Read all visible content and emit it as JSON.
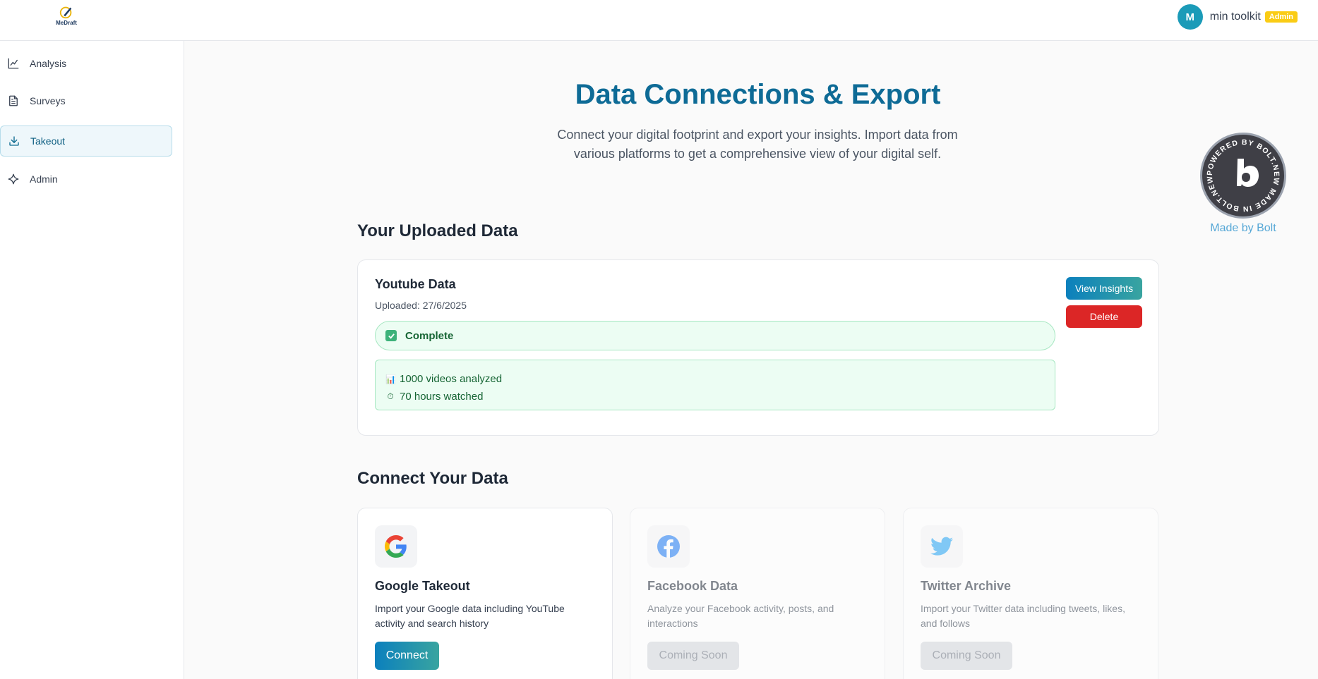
{
  "app": {
    "logo_text": "MeDraft",
    "user": {
      "avatar_initial": "M",
      "name": "min toolkit",
      "role_badge": "Admin"
    }
  },
  "sidebar": {
    "items": [
      {
        "label": "Analysis",
        "icon": "chart-line-icon",
        "active": false
      },
      {
        "label": "Surveys",
        "icon": "document-icon",
        "active": false
      },
      {
        "label": "Takeout",
        "icon": "download-icon",
        "active": true
      },
      {
        "label": "Admin",
        "icon": "sparkle-icon",
        "active": false
      }
    ]
  },
  "main": {
    "title": "Data Connections & Export",
    "subtitle": "Connect your digital footprint and export your insights. Import data from various platforms to get a comprehensive view of your digital self.",
    "uploaded_section_title": "Your Uploaded Data",
    "uploaded": {
      "name": "Youtube Data",
      "uploaded_date": "Uploaded: 27/6/2025",
      "status": "Complete",
      "stats": [
        {
          "icon": "📊",
          "text": "1000 videos analyzed"
        },
        {
          "icon": "⏱",
          "text": "70 hours watched"
        }
      ],
      "view_insights_label": "View Insights",
      "delete_label": "Delete"
    },
    "connect_section_title": "Connect Your Data",
    "connections": [
      {
        "name": "Google Takeout",
        "description": "Import your Google data including YouTube activity and search history",
        "button": "Connect",
        "available": true,
        "icon": "google-icon"
      },
      {
        "name": "Facebook Data",
        "description": "Analyze your Facebook activity, posts, and interactions",
        "button": "Coming Soon",
        "available": false,
        "icon": "facebook-icon"
      },
      {
        "name": "Twitter Archive",
        "description": "Import your Twitter data including tweets, likes, and follows",
        "button": "Coming Soon",
        "available": false,
        "icon": "twitter-icon"
      }
    ]
  },
  "bolt": {
    "ring_text": "POWERED BY BOLT.NEW MADE IN BOLT.NEW",
    "caption": "Made by Bolt"
  },
  "colors": {
    "accent": "#0e6b96",
    "success_bg": "#ecfdf3",
    "danger": "#dc2626",
    "badge": "#facc15"
  }
}
